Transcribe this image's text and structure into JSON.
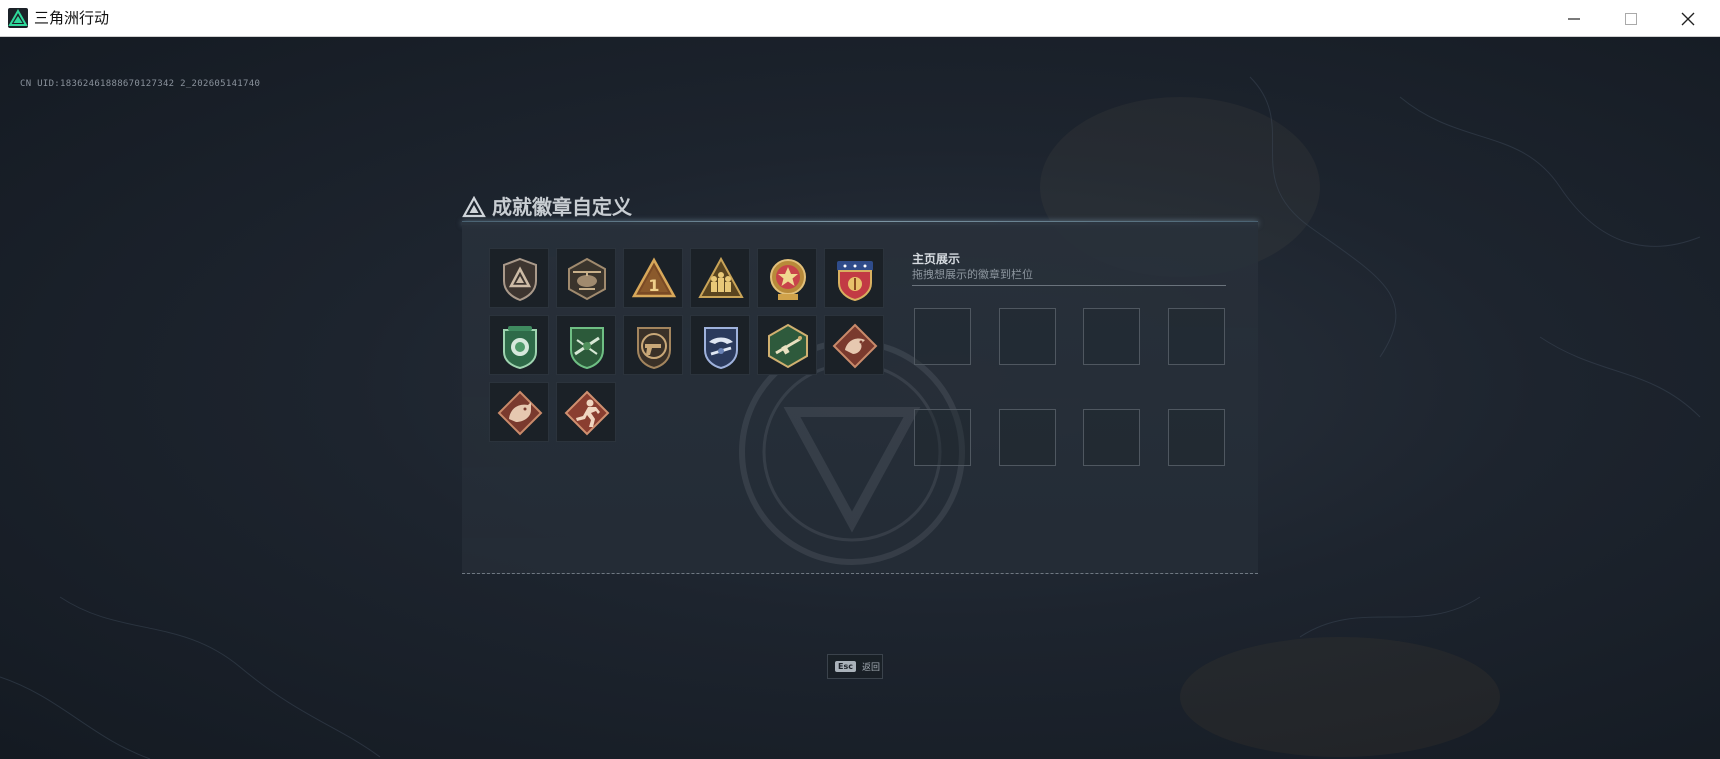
{
  "window": {
    "title": "三角洲行动",
    "icon": "delta-force-logo-icon",
    "controls": [
      "minimize-icon",
      "maximize-icon",
      "close-icon"
    ]
  },
  "game": {
    "uid_text": "CN UID:18362461888670127342 2_202605141740",
    "dialog": {
      "title": "成就徽章自定义",
      "title_icon": "delta-triangle-icon",
      "badges": [
        {
          "icon": "shield-delta-badge",
          "color": "#a9998a"
        },
        {
          "icon": "helicopter-badge",
          "color": "#a08a6e"
        },
        {
          "icon": "rank-one-triangle-badge",
          "color": "#c49a4e"
        },
        {
          "icon": "squad-triangle-badge",
          "color": "#c9a458"
        },
        {
          "icon": "star-medal-badge",
          "color": "#c8434a"
        },
        {
          "icon": "blue-ribbon-badge",
          "color": "#c23a44"
        },
        {
          "icon": "green-lion-badge",
          "color": "#4f9a6a"
        },
        {
          "icon": "green-rifle-badge",
          "color": "#4f8f5a"
        },
        {
          "icon": "bronze-pistol-badge",
          "color": "#a3855e"
        },
        {
          "icon": "blue-eagle-badge",
          "color": "#6a82b5"
        },
        {
          "icon": "green-hex-rifle-badge",
          "color": "#5a9a6a"
        },
        {
          "icon": "red-dragon-badge",
          "color": "#9c4b3b"
        },
        {
          "icon": "red-wolf-badge",
          "color": "#9c4b3b"
        },
        {
          "icon": "red-runner-badge",
          "color": "#a0503c"
        }
      ],
      "showcase": {
        "title": "主页展示",
        "subtitle": "拖拽想展示的徽章到栏位",
        "slot_count": 8
      }
    },
    "esc": {
      "key": "Esc",
      "label": "返回"
    }
  }
}
